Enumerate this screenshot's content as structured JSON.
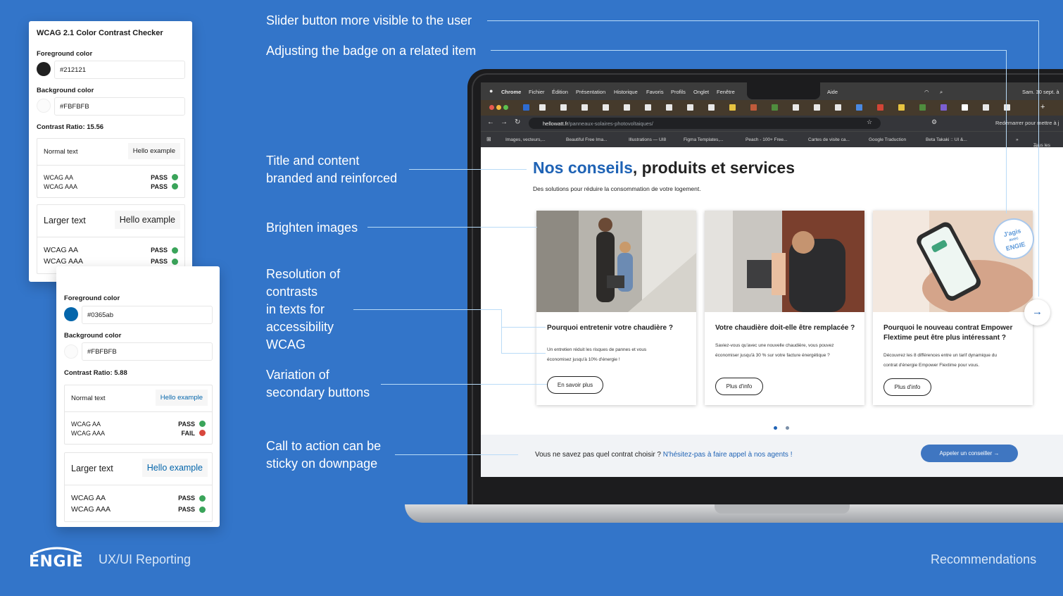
{
  "checker1": {
    "title": "WCAG 2.1 Color Contrast Checker",
    "fg_label": "Foreground color",
    "fg_value": "#212121",
    "fg_color": "#212121",
    "bg_label": "Background color",
    "bg_value": "#FBFBFB",
    "bg_color": "#FBFBFB",
    "ratio": "Contrast Ratio: 15.56",
    "normal_label": "Normal text",
    "normal_example": "Hello example",
    "normal_aa": "WCAG AA",
    "normal_aa_result": "PASS",
    "normal_aaa": "WCAG AAA",
    "normal_aaa_result": "PASS",
    "large_label": "Larger text",
    "large_example": "Hello example",
    "large_aa": "WCAG AA",
    "large_aa_result": "PASS",
    "large_aaa": "WCAG AAA",
    "large_aaa_result": "PASS"
  },
  "checker2": {
    "fg_label": "Foreground color",
    "fg_value": "#0365ab",
    "fg_color": "#0365ab",
    "bg_label": "Background color",
    "bg_value": "#FBFBFB",
    "bg_color": "#FBFBFB",
    "ratio": "Contrast Ratio: 5.88",
    "normal_label": "Normal text",
    "normal_example": "Hello example",
    "normal_aa": "WCAG AA",
    "normal_aa_result": "PASS",
    "normal_aaa": "WCAG AAA",
    "normal_aaa_result": "FAIL",
    "large_label": "Larger text",
    "large_example": "Hello example",
    "large_aa": "WCAG AA",
    "large_aa_result": "PASS",
    "large_aaa": "WCAG AAA",
    "large_aaa_result": "PASS"
  },
  "annotations": {
    "slider": "Slider button more visible to the user",
    "badge": "Adjusting the badge on a related item",
    "title_l1": "Title and content",
    "title_l2": "branded and reinforced",
    "images": "Brighten images",
    "res_l1": "Resolution of",
    "res_l2": "contrasts",
    "res_l3": "in texts for",
    "res_l4": "accessibility",
    "res_l5": "WCAG",
    "var_l1": "Variation of",
    "var_l2": "secondary buttons",
    "cta_l1": "Call to action can be",
    "cta_l2": "sticky on downpage"
  },
  "browser": {
    "menu": [
      "Chrome",
      "Fichier",
      "Édition",
      "Présentation",
      "Historique",
      "Favoris",
      "Profils",
      "Onglet",
      "Fenêtre"
    ],
    "help": "Aide",
    "clock": "Sam. 30 sept. à",
    "url_host": "hellowatt.fr",
    "url_path": "/panneaux-solaires-photovoltaiques/",
    "restart": "Redémarrer pour mettre à j",
    "bookmarks": [
      "Images, vecteurs,...",
      "Beautiful Free Ima...",
      "Illustrations — UI8",
      "Figma Templates,...",
      "Peach - 100+ Free...",
      "Cartes de visite ca...",
      "Google Traduction",
      "Beta Takaki :: UI &..."
    ],
    "all_bookmarks": "Tous les"
  },
  "page": {
    "heading_blue": "Nos conseils",
    "heading_rest": ", produits et services",
    "subtitle": "Des solutions pour réduire la consommation de votre logement.",
    "cards": [
      {
        "title": "Pourquoi entretenir votre chaudière ?",
        "text": "Un entretien réduit les risques de pannes et vous économisez jusqu'à 10% d'énergie !",
        "button": "En savoir plus"
      },
      {
        "title": "Votre chaudière doit-elle être remplacée ?",
        "text": "Saviez-vous qu'avec une nouvelle chaudière, vous pouvez économiser jusqu'à 30 % sur votre facture énergétique ?",
        "button": "Plus d'info"
      },
      {
        "title": "Pourquoi le nouveau contrat Empower Flextime peut être plus intéressant ?",
        "text": "Découvrez les 8 différences entre un tarif dynamique du contrat d'énergie Empower Flextime pour vous.",
        "button": "Plus d'info"
      }
    ],
    "badge_l1": "J'agis",
    "badge_l2": "avec",
    "badge_l3": "ENGIE",
    "cta_question": "Vous ne savez pas quel contrat choisir ?",
    "cta_link": "N'hésitez-pas à faire appel à nos agents !",
    "cta_button": "Appeler un conseiller →"
  },
  "footer": {
    "logo": "ENGIE",
    "title": "UX/UI Reporting",
    "right": "Recommendations"
  },
  "colors": {
    "background": "#3375c9",
    "engie_blue": "#1f63b5",
    "pass": "#3aa45a",
    "fail": "#d7473d"
  }
}
